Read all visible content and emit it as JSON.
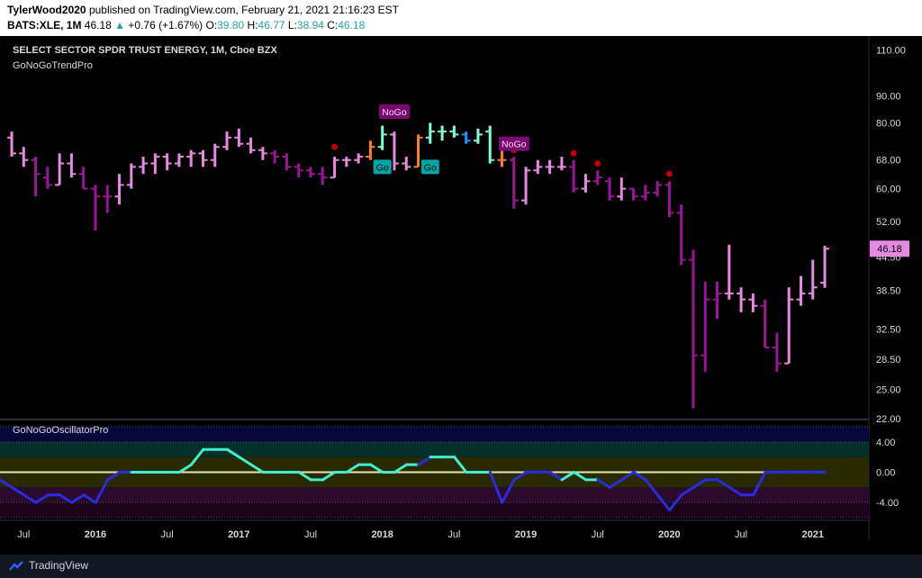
{
  "header": {
    "author": "TylerWood2020",
    "published": "published on TradingView.com, February 21, 2021 21:16:23 EST",
    "symbol": "BATS:XLE, 1M",
    "last": "46.18",
    "change": "+0.76 (+1.67%)",
    "o_label": "O:",
    "o_val": "39.80",
    "h_label": "H:",
    "h_val": "46.77",
    "l_label": "L:",
    "l_val": "38.94",
    "c_label": "C:",
    "c_val": "46.18"
  },
  "main_pane": {
    "title": "SELECT SECTOR SPDR TRUST ENERGY, 1M, Cboe BZX",
    "indicator": "GoNoGoTrendPro",
    "last_price_label": "46.18"
  },
  "osc_pane": {
    "title": "GoNoGoOscillatorPro"
  },
  "footer": {
    "brand": "TradingView"
  },
  "colors": {
    "bg": "#000000",
    "strong_go": "#7effd4",
    "go": "#1e90ff",
    "nogo": "#9b1596",
    "weak_nogo": "#e58ae0",
    "amber": "#ff7f27",
    "dot": "#c00000"
  },
  "chart_data": [
    {
      "type": "ohlc",
      "title": "SELECT SECTOR SPDR TRUST ENERGY, 1M, Cboe BZX",
      "ylim": [
        22,
        115
      ],
      "y_scale": "log",
      "y_ticks": [
        "110.00",
        "90.00",
        "80.00",
        "68.00",
        "60.00",
        "52.00",
        "44.50",
        "38.50",
        "32.50",
        "28.50",
        "25.00",
        "22.00"
      ],
      "x_ticks": [
        "Jul",
        "2016",
        "Jul",
        "2017",
        "Jul",
        "2018",
        "Jul",
        "2019",
        "Jul",
        "2020",
        "Jul",
        "2021"
      ],
      "grid": false,
      "bars": [
        {
          "t": "2015-06",
          "o": 75,
          "h": 77,
          "l": 69,
          "c": 70,
          "k": "weak_nogo"
        },
        {
          "t": "2015-07",
          "o": 70,
          "h": 72,
          "l": 66,
          "c": 68,
          "k": "weak_nogo"
        },
        {
          "t": "2015-08",
          "o": 68,
          "h": 69,
          "l": 58,
          "c": 64,
          "k": "nogo"
        },
        {
          "t": "2015-09",
          "o": 63,
          "h": 66,
          "l": 60,
          "c": 61,
          "k": "nogo"
        },
        {
          "t": "2015-10",
          "o": 61,
          "h": 70,
          "l": 61,
          "c": 67,
          "k": "weak_nogo"
        },
        {
          "t": "2015-11",
          "o": 67,
          "h": 70,
          "l": 63,
          "c": 64,
          "k": "weak_nogo"
        },
        {
          "t": "2015-12",
          "o": 64,
          "h": 66,
          "l": 60,
          "c": 60,
          "k": "nogo"
        },
        {
          "t": "2016-01",
          "o": 60,
          "h": 61,
          "l": 50,
          "c": 58,
          "k": "nogo"
        },
        {
          "t": "2016-02",
          "o": 58,
          "h": 61,
          "l": 54,
          "c": 58,
          "k": "nogo"
        },
        {
          "t": "2016-03",
          "o": 58,
          "h": 64,
          "l": 56,
          "c": 61,
          "k": "weak_nogo"
        },
        {
          "t": "2016-04",
          "o": 61,
          "h": 67,
          "l": 60,
          "c": 66,
          "k": "weak_nogo"
        },
        {
          "t": "2016-05",
          "o": 66,
          "h": 69,
          "l": 64,
          "c": 67,
          "k": "weak_nogo"
        },
        {
          "t": "2016-06",
          "o": 67,
          "h": 70,
          "l": 64,
          "c": 69,
          "k": "weak_nogo"
        },
        {
          "t": "2016-07",
          "o": 69,
          "h": 70,
          "l": 65,
          "c": 67,
          "k": "weak_nogo"
        },
        {
          "t": "2016-08",
          "o": 67,
          "h": 70,
          "l": 66,
          "c": 69,
          "k": "weak_nogo"
        },
        {
          "t": "2016-09",
          "o": 69,
          "h": 71,
          "l": 66,
          "c": 70,
          "k": "weak_nogo"
        },
        {
          "t": "2016-10",
          "o": 70,
          "h": 71,
          "l": 66,
          "c": 68,
          "k": "weak_nogo"
        },
        {
          "t": "2016-11",
          "o": 68,
          "h": 73,
          "l": 66,
          "c": 72,
          "k": "weak_nogo"
        },
        {
          "t": "2016-12",
          "o": 72,
          "h": 77,
          "l": 71,
          "c": 75,
          "k": "weak_nogo"
        },
        {
          "t": "2017-01",
          "o": 75,
          "h": 78,
          "l": 72,
          "c": 73,
          "k": "weak_nogo"
        },
        {
          "t": "2017-02",
          "o": 73,
          "h": 75,
          "l": 70,
          "c": 71,
          "k": "weak_nogo"
        },
        {
          "t": "2017-03",
          "o": 71,
          "h": 72,
          "l": 68,
          "c": 70,
          "k": "weak_nogo"
        },
        {
          "t": "2017-04",
          "o": 70,
          "h": 71,
          "l": 67,
          "c": 69,
          "k": "nogo"
        },
        {
          "t": "2017-05",
          "o": 69,
          "h": 70,
          "l": 65,
          "c": 66,
          "k": "nogo"
        },
        {
          "t": "2017-06",
          "o": 66,
          "h": 67,
          "l": 63,
          "c": 65,
          "k": "nogo"
        },
        {
          "t": "2017-07",
          "o": 65,
          "h": 66,
          "l": 63,
          "c": 64,
          "k": "nogo"
        },
        {
          "t": "2017-08",
          "o": 64,
          "h": 66,
          "l": 61,
          "c": 63,
          "k": "nogo"
        },
        {
          "t": "2017-09",
          "o": 63,
          "h": 69,
          "l": 63,
          "c": 68,
          "k": "weak_nogo"
        },
        {
          "t": "2017-10",
          "o": 68,
          "h": 69,
          "l": 66,
          "c": 68,
          "k": "weak_nogo"
        },
        {
          "t": "2017-11",
          "o": 68,
          "h": 70,
          "l": 67,
          "c": 69,
          "k": "weak_nogo"
        },
        {
          "t": "2017-12",
          "o": 69,
          "h": 74,
          "l": 68,
          "c": 72,
          "k": "amber"
        },
        {
          "t": "2018-01",
          "o": 72,
          "h": 79,
          "l": 71,
          "c": 76,
          "k": "strong_go"
        },
        {
          "t": "2018-02",
          "o": 76,
          "h": 77,
          "l": 65,
          "c": 67,
          "k": "weak_nogo"
        },
        {
          "t": "2018-03",
          "o": 67,
          "h": 69,
          "l": 65,
          "c": 66,
          "k": "weak_nogo"
        },
        {
          "t": "2018-04",
          "o": 66,
          "h": 76,
          "l": 66,
          "c": 75,
          "k": "amber"
        },
        {
          "t": "2018-05",
          "o": 75,
          "h": 80,
          "l": 73,
          "c": 77,
          "k": "strong_go"
        },
        {
          "t": "2018-06",
          "o": 77,
          "h": 79,
          "l": 74,
          "c": 77,
          "k": "strong_go"
        },
        {
          "t": "2018-07",
          "o": 77,
          "h": 79,
          "l": 75,
          "c": 76,
          "k": "strong_go"
        },
        {
          "t": "2018-08",
          "o": 76,
          "h": 77,
          "l": 73,
          "c": 74,
          "k": "go"
        },
        {
          "t": "2018-09",
          "o": 74,
          "h": 78,
          "l": 73,
          "c": 76,
          "k": "strong_go"
        },
        {
          "t": "2018-10",
          "o": 77,
          "h": 79,
          "l": 67,
          "c": 68,
          "k": "strong_go"
        },
        {
          "t": "2018-11",
          "o": 68,
          "h": 71,
          "l": 66,
          "c": 68,
          "k": "amber"
        },
        {
          "t": "2018-12",
          "o": 68,
          "h": 69,
          "l": 55,
          "c": 57,
          "k": "nogo"
        },
        {
          "t": "2019-01",
          "o": 57,
          "h": 66,
          "l": 56,
          "c": 65,
          "k": "weak_nogo"
        },
        {
          "t": "2019-02",
          "o": 65,
          "h": 68,
          "l": 64,
          "c": 66,
          "k": "weak_nogo"
        },
        {
          "t": "2019-03",
          "o": 66,
          "h": 68,
          "l": 64,
          "c": 66,
          "k": "weak_nogo"
        },
        {
          "t": "2019-04",
          "o": 66,
          "h": 69,
          "l": 65,
          "c": 66,
          "k": "weak_nogo"
        },
        {
          "t": "2019-05",
          "o": 66,
          "h": 68,
          "l": 59,
          "c": 60,
          "k": "nogo"
        },
        {
          "t": "2019-06",
          "o": 60,
          "h": 64,
          "l": 59,
          "c": 62,
          "k": "weak_nogo"
        },
        {
          "t": "2019-07",
          "o": 62,
          "h": 65,
          "l": 61,
          "c": 63,
          "k": "nogo"
        },
        {
          "t": "2019-08",
          "o": 62,
          "h": 63,
          "l": 57,
          "c": 58,
          "k": "nogo"
        },
        {
          "t": "2019-09",
          "o": 58,
          "h": 63,
          "l": 57,
          "c": 60,
          "k": "weak_nogo"
        },
        {
          "t": "2019-10",
          "o": 60,
          "h": 60,
          "l": 57,
          "c": 58,
          "k": "nogo"
        },
        {
          "t": "2019-11",
          "o": 58,
          "h": 61,
          "l": 57,
          "c": 59,
          "k": "nogo"
        },
        {
          "t": "2019-12",
          "o": 59,
          "h": 62,
          "l": 58,
          "c": 61,
          "k": "nogo"
        },
        {
          "t": "2020-01",
          "o": 61,
          "h": 62,
          "l": 53,
          "c": 54,
          "k": "nogo"
        },
        {
          "t": "2020-02",
          "o": 54,
          "h": 56,
          "l": 43,
          "c": 44,
          "k": "nogo"
        },
        {
          "t": "2020-03",
          "o": 44,
          "h": 46,
          "l": 23,
          "c": 29,
          "k": "nogo"
        },
        {
          "t": "2020-04",
          "o": 29,
          "h": 40,
          "l": 27,
          "c": 37,
          "k": "nogo"
        },
        {
          "t": "2020-05",
          "o": 37,
          "h": 40,
          "l": 34,
          "c": 38,
          "k": "nogo"
        },
        {
          "t": "2020-06",
          "o": 38,
          "h": 47,
          "l": 37,
          "c": 38,
          "k": "weak_nogo"
        },
        {
          "t": "2020-07",
          "o": 38,
          "h": 39,
          "l": 35,
          "c": 37,
          "k": "weak_nogo"
        },
        {
          "t": "2020-08",
          "o": 37,
          "h": 38,
          "l": 35,
          "c": 36,
          "k": "weak_nogo"
        },
        {
          "t": "2020-09",
          "o": 36,
          "h": 37,
          "l": 30,
          "c": 30,
          "k": "nogo"
        },
        {
          "t": "2020-10",
          "o": 30,
          "h": 32,
          "l": 27,
          "c": 28,
          "k": "nogo"
        },
        {
          "t": "2020-11",
          "o": 28,
          "h": 39,
          "l": 28,
          "c": 37,
          "k": "weak_nogo"
        },
        {
          "t": "2020-12",
          "o": 37,
          "h": 41,
          "l": 36,
          "c": 38,
          "k": "weak_nogo"
        },
        {
          "t": "2021-01",
          "o": 38,
          "h": 44,
          "l": 37,
          "c": 39,
          "k": "weak_nogo"
        },
        {
          "t": "2021-02",
          "o": 39.8,
          "h": 46.77,
          "l": 38.94,
          "c": 46.18,
          "k": "weak_nogo"
        }
      ],
      "labels": [
        {
          "text": "Go",
          "t": "2018-01",
          "y": 66,
          "k": "label_go"
        },
        {
          "text": "Go",
          "t": "2018-05",
          "y": 66,
          "k": "label_go"
        },
        {
          "text": "NoGo",
          "t": "2018-02",
          "y": 84,
          "k": "label_nogo"
        },
        {
          "text": "NoGo",
          "t": "2018-12",
          "y": 73,
          "k": "label_nogo"
        }
      ],
      "dots": [
        {
          "t": "2017-09",
          "y": 72
        },
        {
          "t": "2018-12",
          "y": 71
        },
        {
          "t": "2019-05",
          "y": 70
        },
        {
          "t": "2019-07",
          "y": 67
        },
        {
          "t": "2020-01",
          "y": 64
        }
      ]
    },
    {
      "type": "line",
      "title": "GoNoGoOscillatorPro",
      "ylim": [
        -6,
        6
      ],
      "y_ticks": [
        "4.00",
        "0.00",
        "-4.00"
      ],
      "values": [
        -1,
        -2,
        -3,
        -4,
        -3,
        -3,
        -4,
        -3,
        -4,
        -1,
        0,
        0,
        0,
        0,
        0,
        0,
        1,
        3,
        3,
        3,
        2,
        1,
        0,
        0,
        0,
        0,
        -1,
        -1,
        0,
        0,
        1,
        1,
        0,
        0,
        1,
        1,
        2,
        2,
        2,
        0,
        0,
        0,
        -4,
        -1,
        0,
        0,
        0,
        -1,
        0,
        -1,
        -1,
        -2,
        -1,
        0,
        -1,
        -3,
        -5,
        -3,
        -2,
        -1,
        -1,
        -2,
        -3,
        -3,
        0,
        0,
        0,
        0,
        0,
        0
      ],
      "kinds": [
        "go",
        "go",
        "go",
        "go",
        "go",
        "go",
        "go",
        "go",
        "go",
        "go",
        "go",
        "strong_go",
        "strong_go",
        "strong_go",
        "strong_go",
        "strong_go",
        "strong_go",
        "strong_go",
        "strong_go",
        "strong_go",
        "strong_go",
        "strong_go",
        "strong_go",
        "strong_go",
        "strong_go",
        "strong_go",
        "strong_go",
        "strong_go",
        "strong_go",
        "strong_go",
        "strong_go",
        "strong_go",
        "strong_go",
        "strong_go",
        "strong_go",
        "go",
        "strong_go",
        "strong_go",
        "strong_go",
        "strong_go",
        "strong_go",
        "go",
        "go",
        "go",
        "go",
        "go",
        "go",
        "strong_go",
        "strong_go",
        "strong_go",
        "go",
        "go",
        "go",
        "go",
        "go",
        "go",
        "go",
        "go",
        "go",
        "go",
        "go",
        "go",
        "go",
        "go",
        "go",
        "go",
        "go",
        "go",
        "go",
        "go"
      ]
    }
  ]
}
